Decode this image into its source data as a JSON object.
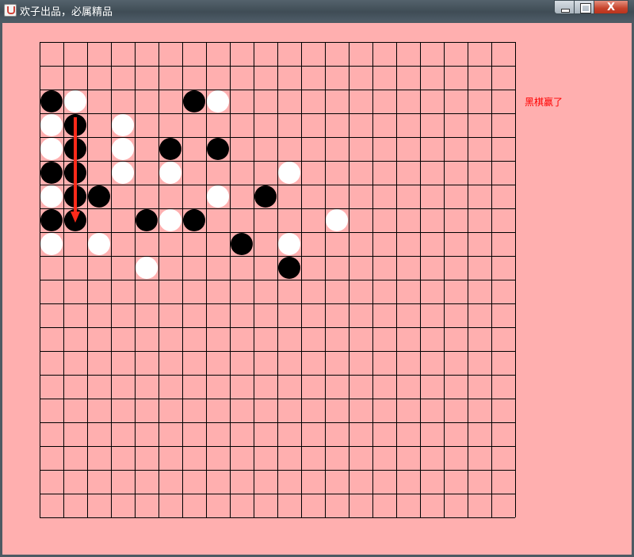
{
  "window": {
    "title": "欢子出品，必属精品",
    "buttons": {
      "close_glyph": "X"
    }
  },
  "status_text": "黑棋赢了",
  "colors": {
    "background": "#ffafaf",
    "grid_line": "#000000",
    "black_stone": "#000000",
    "white_stone": "#ffffff",
    "status_text": "#ff0000",
    "win_arrow": "#ff2a1a"
  },
  "board": {
    "columns": 21,
    "rows": 21,
    "black_stones": [
      [
        0,
        2
      ],
      [
        6,
        2
      ],
      [
        1,
        3
      ],
      [
        1,
        4
      ],
      [
        5,
        4
      ],
      [
        7,
        4
      ],
      [
        0,
        5
      ],
      [
        1,
        5
      ],
      [
        1,
        6
      ],
      [
        2,
        6
      ],
      [
        9,
        6
      ],
      [
        0,
        7
      ],
      [
        1,
        7
      ],
      [
        4,
        7
      ],
      [
        6,
        7
      ],
      [
        8,
        8
      ],
      [
        10,
        9
      ]
    ],
    "white_stones": [
      [
        1,
        2
      ],
      [
        7,
        2
      ],
      [
        0,
        3
      ],
      [
        3,
        3
      ],
      [
        0,
        4
      ],
      [
        3,
        4
      ],
      [
        3,
        5
      ],
      [
        5,
        5
      ],
      [
        10,
        5
      ],
      [
        0,
        6
      ],
      [
        7,
        6
      ],
      [
        5,
        7
      ],
      [
        12,
        7
      ],
      [
        0,
        8
      ],
      [
        2,
        8
      ],
      [
        10,
        8
      ],
      [
        4,
        9
      ]
    ],
    "winning_line": {
      "from": [
        1,
        3
      ],
      "to": [
        1,
        7
      ]
    }
  }
}
